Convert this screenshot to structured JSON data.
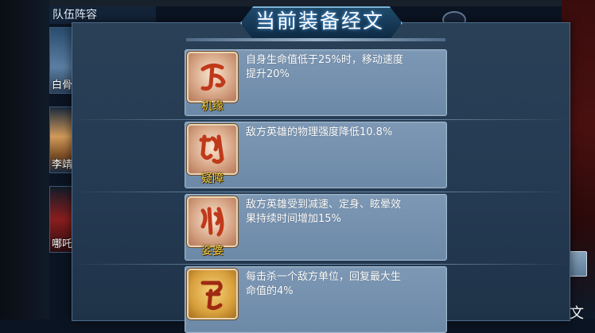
{
  "background": {
    "team_title": "队伍阵容",
    "heroes": [
      {
        "name": "白骨"
      },
      {
        "name": "李靖"
      },
      {
        "name": "哪吒"
      }
    ],
    "corner_text": "文"
  },
  "modal": {
    "title": "当前装备经文",
    "scrolls": [
      {
        "name": "机缘",
        "description": "自身生命值低于25%时，移动速度提升20%",
        "icon": "rune-icon"
      },
      {
        "name": "疑障",
        "description": "敌方英雄的物理强度降低10.8%",
        "icon": "rune-icon"
      },
      {
        "name": "娑婆",
        "description": "敌方英雄受到减速、定身、眩晕效果持续时间增加15%",
        "icon": "rune-icon"
      },
      {
        "name": "",
        "description": "每击杀一个敌方单位，回复最大生命值的4%",
        "icon": "rune-icon"
      }
    ]
  },
  "colors": {
    "scroll_name": "#ffcf3d",
    "card_bg": "#7d98b5",
    "modal_bg": "#243a52"
  }
}
